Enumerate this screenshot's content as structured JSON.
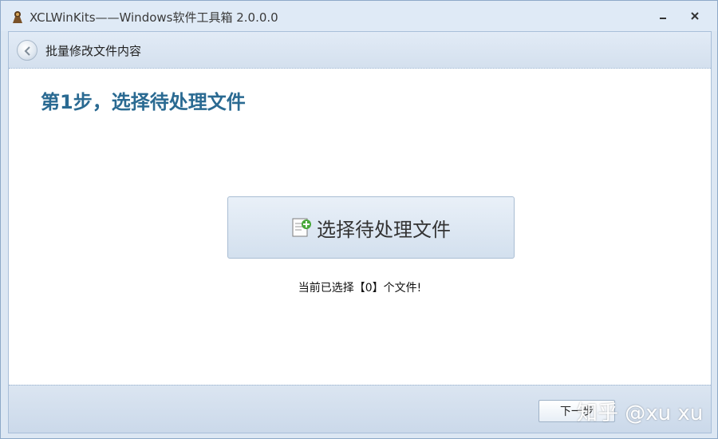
{
  "window": {
    "title": "XCLWinKits——Windows软件工具箱 2.0.0.0",
    "minimize_icon": "minimize-icon",
    "close_icon": "close-icon"
  },
  "header": {
    "back_icon": "back-arrow-icon",
    "title": "批量修改文件内容"
  },
  "main": {
    "step_prefix": "第",
    "step_number": "1",
    "step_suffix": "步，选择待处理文件",
    "select_button_label": "选择待处理文件",
    "select_button_icon": "add-file-icon",
    "status": "当前已选择【0】个文件!"
  },
  "footer": {
    "next_button_label": "下一步"
  },
  "watermark": {
    "text": "知乎 @xu xu"
  },
  "colors": {
    "heading": "#2a6a92",
    "frame": "#dce7f3",
    "border": "#8da9c8"
  }
}
